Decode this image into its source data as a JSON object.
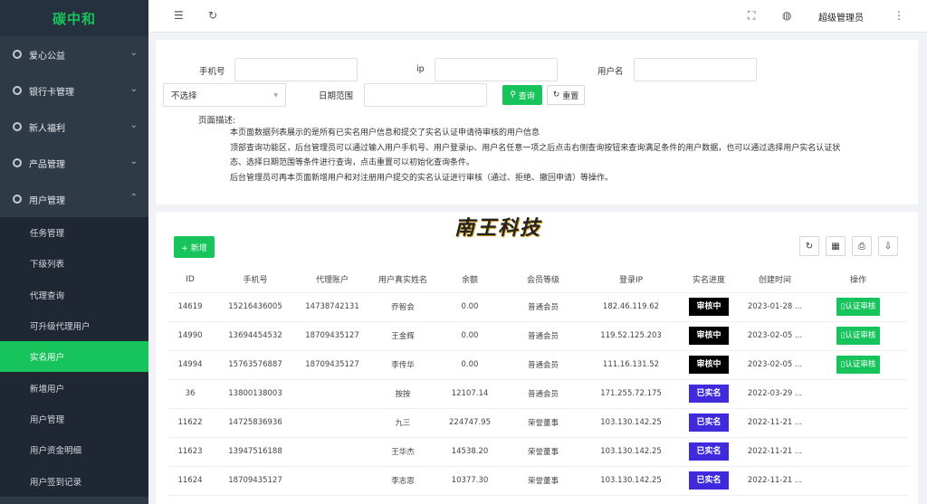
{
  "app": {
    "logo": "碳中和"
  },
  "sidebar": {
    "groups": [
      {
        "label": "爱心公益",
        "icon": "gear-icon",
        "arrow": "⌄"
      },
      {
        "label": "银行卡管理",
        "icon": "gear-icon",
        "arrow": "⌄"
      },
      {
        "label": "新人福利",
        "icon": "gear-icon",
        "arrow": "⌄"
      },
      {
        "label": "产品管理",
        "icon": "gear-icon",
        "arrow": "⌄"
      },
      {
        "label": "用户管理",
        "icon": "gear-icon",
        "arrow": "⌃"
      }
    ],
    "sub_items": [
      "任务管理",
      "下级列表",
      "代理查询",
      "可升级代理用户",
      "实名用户",
      "新增用户",
      "用户管理",
      "用户资金明细",
      "用户签到记录"
    ],
    "active_sub": "实名用户"
  },
  "topbar": {
    "admin": "超级管理员"
  },
  "search": {
    "phone_label": "手机号",
    "ip_label": "ip",
    "username_label": "用户名",
    "select_value": "不选择",
    "date_label": "日期范围",
    "query_label": "查询",
    "reset_label": "重置",
    "desc_label": "页面描述:",
    "desc_lines": [
      "本页面数据列表展示的是所有已实名用户信息和提交了实名认证申请待审核的用户信息",
      "顶部查询功能区，后台管理员可以通过输入用户手机号、用户登录ip、用户名任意一项之后点击右侧查询按钮来查询满足条件的用户数据，也可以通过选择用户实名认证状",
      "态、选择日期范围等条件进行查询，点击重置可以初始化查询条件。",
      "后台管理员可再本页面新增用户和对注册用户提交的实名认证进行审核（通过、拒绝、撤回申请）等操作。"
    ]
  },
  "table": {
    "add_label": "+ 新增",
    "watermark": "南王科技",
    "columns": [
      "ID",
      "手机号",
      "代理账户",
      "用户真实姓名",
      "余额",
      "会员等级",
      "登录IP",
      "实名进度",
      "创建时间",
      "操作"
    ],
    "rows": [
      {
        "id": "14619",
        "phone": "15216436005",
        "agent": "14738742131",
        "name": "乔智会",
        "balance": "0.00",
        "level": "普通会员",
        "ip": "182.46.119.62",
        "status": "审核中",
        "status_type": "pending",
        "created": "2023-01-28 ...",
        "action": "认证审核"
      },
      {
        "id": "14990",
        "phone": "13694454532",
        "agent": "18709435127",
        "name": "王金辉",
        "balance": "0.00",
        "level": "普通会员",
        "ip": "119.52.125.203",
        "status": "审核中",
        "status_type": "pending",
        "created": "2023-02-05 ...",
        "action": "认证审核"
      },
      {
        "id": "14994",
        "phone": "15763576887",
        "agent": "18709435127",
        "name": "李传华",
        "balance": "0.00",
        "level": "普通会员",
        "ip": "111.16.131.52",
        "status": "审核中",
        "status_type": "pending",
        "created": "2023-02-05 ...",
        "action": "认证审核"
      },
      {
        "id": "36",
        "phone": "13800138003",
        "agent": "",
        "name": "按按",
        "balance": "12107.14",
        "level": "普通会员",
        "ip": "171.255.72.175",
        "status": "已实名",
        "status_type": "verified",
        "created": "2022-03-29 ...",
        "action": ""
      },
      {
        "id": "11622",
        "phone": "14725836936",
        "agent": "",
        "name": "九三",
        "balance": "224747.95",
        "level": "荣誉董事",
        "ip": "103.130.142.25",
        "status": "已实名",
        "status_type": "verified",
        "created": "2022-11-21 ...",
        "action": ""
      },
      {
        "id": "11623",
        "phone": "13947516188",
        "agent": "",
        "name": "王华杰",
        "balance": "14538.20",
        "level": "荣誉董事",
        "ip": "103.130.142.25",
        "status": "已实名",
        "status_type": "verified",
        "created": "2022-11-21 ...",
        "action": ""
      },
      {
        "id": "11624",
        "phone": "18709435127",
        "agent": "",
        "name": "李志恩",
        "balance": "10377.30",
        "level": "荣誉董事",
        "ip": "103.130.142.25",
        "status": "已实名",
        "status_type": "verified",
        "created": "2022-11-21 ...",
        "action": ""
      }
    ]
  },
  "colors": {
    "accent": "#17c35b",
    "sidebar": "#2f3a47",
    "verified": "#3f2bdb",
    "pending": "#000000"
  }
}
